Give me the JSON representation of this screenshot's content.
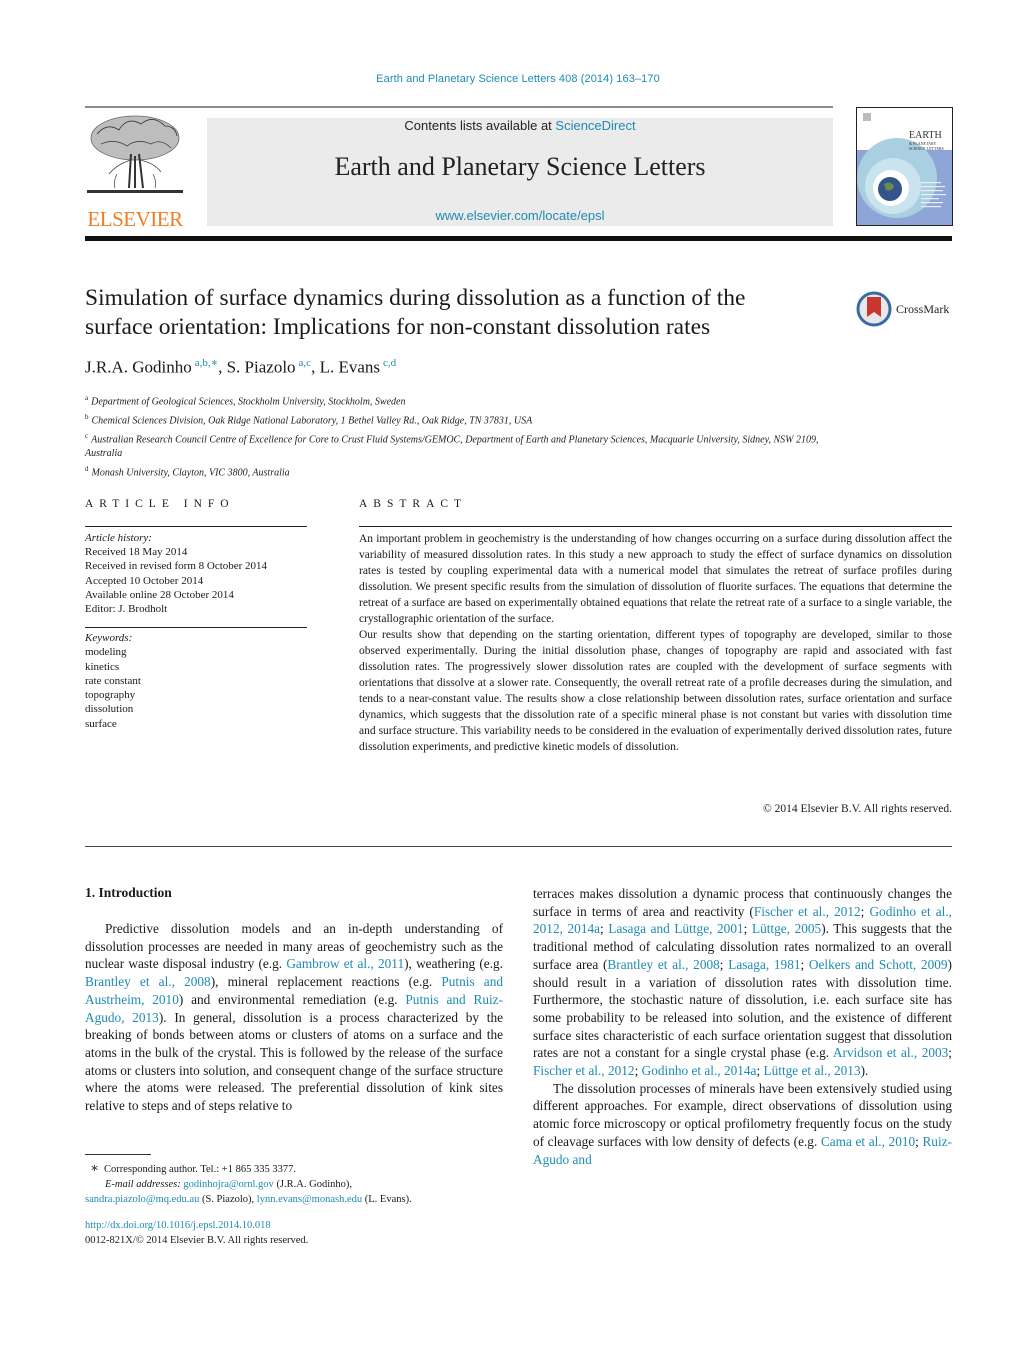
{
  "header": {
    "journal_ref": "Earth and Planetary Science Letters 408 (2014) 163–170",
    "contents_prefix": "Contents lists available at ",
    "contents_link": "ScienceDirect",
    "journal_title": "Earth and Planetary Science Letters",
    "journal_url": "www.elsevier.com/locate/epsl",
    "publisher_logo": "ELSEVIER",
    "cover_title": [
      "EARTH",
      "& PLANETARY",
      "SCIENCE LETTERS"
    ]
  },
  "article": {
    "title_line1": "Simulation of surface dynamics during dissolution as a function of the",
    "title_line2": "surface orientation: Implications for non-constant dissolution rates",
    "crossmark_label": "CrossMark",
    "authors": [
      {
        "name": "J.R.A. Godinho",
        "sup": "a,b,∗",
        "sep": ", "
      },
      {
        "name": "S. Piazolo",
        "sup": "a,c",
        "sep": ", "
      },
      {
        "name": "L. Evans",
        "sup": "c,d",
        "sep": ""
      }
    ],
    "affiliations": [
      {
        "key": "a",
        "text": "Department of Geological Sciences, Stockholm University, Stockholm, Sweden"
      },
      {
        "key": "b",
        "text": "Chemical Sciences Division, Oak Ridge National Laboratory, 1 Bethel Valley Rd., Oak Ridge, TN 37831, USA"
      },
      {
        "key": "c",
        "text": "Australian Research Council Centre of Excellence for Core to Crust Fluid Systems/GEMOC, Department of Earth and Planetary Sciences, Macquarie University, Sidney, NSW 2109, Australia"
      },
      {
        "key": "d",
        "text": "Monash University, Clayton, VIC 3800, Australia"
      }
    ]
  },
  "article_info": {
    "heading": "ARTICLE INFO",
    "history_label": "Article history:",
    "history": [
      "Received 18 May 2014",
      "Received in revised form 8 October 2014",
      "Accepted 10 October 2014",
      "Available online 28 October 2014",
      "Editor: J. Brodholt"
    ],
    "keywords_label": "Keywords:",
    "keywords": [
      "modeling",
      "kinetics",
      "rate constant",
      "topography",
      "dissolution",
      "surface"
    ]
  },
  "abstract": {
    "heading": "ABSTRACT",
    "p1": "An important problem in geochemistry is the understanding of how changes occurring on a surface during dissolution affect the variability of measured dissolution rates. In this study a new approach to study the effect of surface dynamics on dissolution rates is tested by coupling experimental data with a numerical model that simulates the retreat of surface profiles during dissolution. We present specific results from the simulation of dissolution of fluorite surfaces. The equations that determine the retreat of a surface are based on experimentally obtained equations that relate the retreat rate of a surface to a single variable, the crystallographic orientation of the surface.",
    "p2": "Our results show that depending on the starting orientation, different types of topography are developed, similar to those observed experimentally. During the initial dissolution phase, changes of topography are rapid and associated with fast dissolution rates. The progressively slower dissolution rates are coupled with the development of surface segments with orientations that dissolve at a slower rate. Consequently, the overall retreat rate of a profile decreases during the simulation, and tends to a near-constant value. The results show a close relationship between dissolution rates, surface orientation and surface dynamics, which suggests that the dissolution rate of a specific mineral phase is not constant but varies with dissolution time and surface structure. This variability needs to be considered in the evaluation of experimentally derived dissolution rates, future dissolution experiments, and predictive kinetic models of dissolution.",
    "copyright": "© 2014 Elsevier B.V. All rights reserved."
  },
  "intro": {
    "heading": "1. Introduction",
    "left": {
      "t1": "Predictive dissolution models and an in-depth understanding of dissolution processes are needed in many areas of geochem­istry such as the nuclear waste disposal industry (e.g. ",
      "c1": "Gambrow et al., 2011",
      "t2": "), weathering (e.g. ",
      "c2": "Brantley et al., 2008",
      "t3": "), mineral re­placement reactions (e.g. ",
      "c3": "Putnis and Austrheim, 2010",
      "t4": ") and environ­mental remediation (e.g. ",
      "c4": "Putnis and Ruiz-Agudo, 2013",
      "t5": "). In general, dissolution is a process characterized by the breaking of bonds be­tween atoms or clusters of atoms on a surface and the atoms in the bulk of the crystal. This is followed by the release of the sur­face atoms or clusters into solution, and consequent change of the surface structure where the atoms were released. The preferential dissolution of kink sites relative to steps and of steps relative to"
    },
    "right": {
      "t1": "terraces makes dissolution a dynamic process that continuously changes the surface in terms of area and reactivity (",
      "c1": "Fischer et al., 2012",
      "s1": "; ",
      "c2": "Godinho et al., 2012, 2014a",
      "s2": "; ",
      "c3": "Lasaga and Lüttge, 2001",
      "s3": "; ",
      "c4": "Lüttge, 2005",
      "t2": "). This suggests that the traditional method of cal­culating dissolution rates normalized to an overall surface area (",
      "c5": "Brantley et al., 2008",
      "s4": "; ",
      "c6": "Lasaga, 1981",
      "s5": "; ",
      "c7": "Oelkers and Schott, 2009",
      "t3": ") should result in a variation of dissolution rates with dissolu­tion time. Furthermore, the stochastic nature of dissolution, i.e. each surface site has some probability to be released into so­lution, and the existence of different surface sites characteristic of each surface orientation suggest that dissolution rates are not a constant for a single crystal phase (e.g. ",
      "c8": "Arvidson et al., 2003",
      "s6": "; ",
      "c9": "Fischer et al., 2012",
      "s7": "; ",
      "c10": "Godinho et al., 2014a",
      "s8": "; ",
      "c11": "Lüttge et al., 2013",
      "t4": ").",
      "p2_t1": "The dissolution processes of minerals have been extensively studied using different approaches. For example, direct observa­tions of dissolution using atomic force microscopy or optical pro­filometry frequently focus on the study of cleavage surfaces with low density of defects (e.g. ",
      "p2_c1": "Cama et al., 2010",
      "p2_s1": "; ",
      "p2_c2": "Ruiz-Agudo and"
    }
  },
  "footnotes": {
    "star": "∗",
    "corresponding": "Corresponding author. Tel.: +1 865 335 3377.",
    "email_label": "E-mail addresses:",
    "email1": "godinhojra@ornl.gov",
    "email1_who": " (J.R.A. Godinho),",
    "email2": "sandra.piazolo@mq.edu.au",
    "email2_who": " (S. Piazolo), ",
    "email3": "lynn.evans@monash.edu",
    "email3_who": " (L. Evans).",
    "doi": "http://dx.doi.org/10.1016/j.epsl.2014.10.018",
    "issn": "0012-821X/© 2014 Elsevier B.V. All rights reserved."
  },
  "colors": {
    "link": "#1e8bb4",
    "elsevier_orange": "#f07d22",
    "banner_bg": "#ebebeb"
  }
}
